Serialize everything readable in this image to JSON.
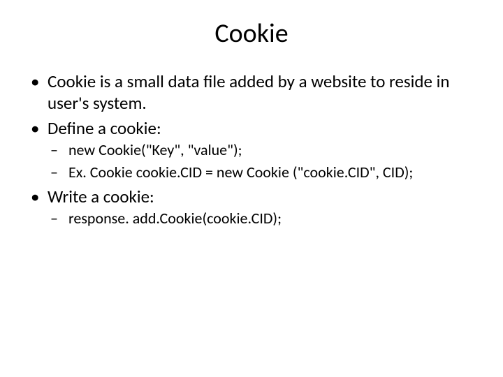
{
  "title": "Cookie",
  "bullets": [
    {
      "text": "Cookie is a small data file added by a website to reside in user's system."
    },
    {
      "text": "Define a cookie:",
      "sub": [
        "new Cookie(\"Key\", \"value\");",
        " Ex. Cookie cookie.CID = new Cookie (\"cookie.CID\", CID);"
      ]
    },
    {
      "text": "Write a cookie:",
      "sub": [
        "response. add.Cookie(cookie.CID);"
      ]
    }
  ]
}
